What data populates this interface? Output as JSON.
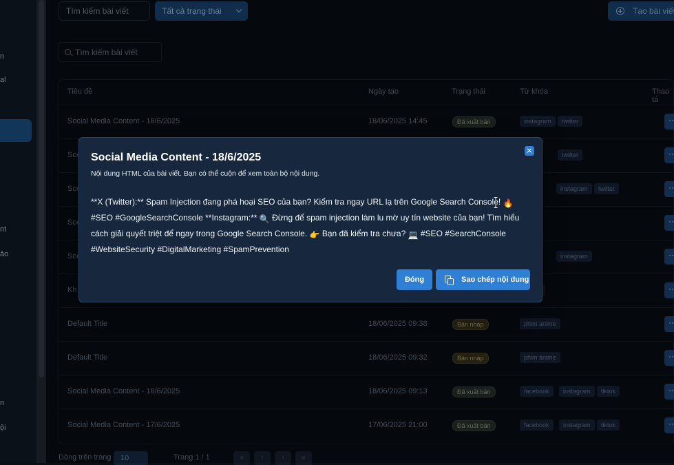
{
  "sidebar": {
    "fragments": [
      "n",
      "al",
      "nt",
      "ảo",
      "n",
      "ội"
    ]
  },
  "filters": {
    "search_placeholder": "Tìm kiếm bài viết",
    "status_label": "Tất cả trạng thái",
    "create_label": "Tạo bài viết"
  },
  "table_search": {
    "placeholder": "Tìm kiếm bài viết"
  },
  "table": {
    "headers": [
      "Tiêu đề",
      "Ngày tạo",
      "Trạng thái",
      "Từ khóa",
      "Thao tá"
    ],
    "rows": [
      {
        "title": "Social Media Content - 18/6/2025",
        "date": "18/06/2025 14:45",
        "status": "Đã xuất bản",
        "keywords": [
          "instagram",
          "twitter"
        ]
      },
      {
        "title": "Soc",
        "date": "",
        "status": "",
        "keywords": [
          "gram",
          "twitter"
        ]
      },
      {
        "title": "Soc",
        "date": "",
        "status": "",
        "keywords": [
          "tok",
          "instagram",
          "twitter"
        ]
      },
      {
        "title": "Soc",
        "date": "",
        "status": "",
        "keywords": [
          "tok"
        ]
      },
      {
        "title": "Soc",
        "date": "",
        "status": "",
        "keywords": [
          "tok",
          "instagram"
        ]
      },
      {
        "title": "Kh",
        "date": "",
        "status": "",
        "keywords": [
          "anime"
        ]
      },
      {
        "title": "Default Title",
        "date": "18/06/2025 09:38",
        "status": "Bản nháp",
        "keywords": [
          "phim anime"
        ]
      },
      {
        "title": "Default Title",
        "date": "18/06/2025 09:32",
        "status": "Bản nháp",
        "keywords": [
          "phim anime"
        ]
      },
      {
        "title": "Social Media Content - 18/6/2025",
        "date": "18/06/2025 09:13",
        "status": "Đã xuất bản",
        "keywords": [
          "facebook",
          "instagram",
          "tiktok"
        ]
      },
      {
        "title": "Social Media Content - 17/6/2025",
        "date": "17/06/2025 21:00",
        "status": "Đã xuất bản",
        "keywords": [
          "facebook",
          "instagram",
          "tiktok"
        ]
      }
    ],
    "action_label": "···"
  },
  "pagination": {
    "rows_label": "Dòng trên trang",
    "rows_value": "10",
    "page_info": "Trang 1 / 1",
    "buttons": [
      "«",
      "‹",
      "›",
      "»"
    ]
  },
  "modal": {
    "title": "Social Media Content - 18/6/2025",
    "subtitle": "Nội dung HTML của bài viết. Bạn có thể cuộn để xem toàn bộ nội dung.",
    "body_part1": "**X (Twitter):** Spam Injection đang phá hoại SEO của bạn? Kiểm tra ngay URL lạ trên Google Search Console! ",
    "emoji1": "🔥",
    "body_part2": " #SEO #GoogleSearchConsole **Instagram:** ",
    "emoji2": "🔍",
    "body_part3": " Đừng để spam injection làm lu mờ uy tín website của bạn! Tìm hiểu cách giải quyết triệt để ngay trong Google Search Console. ",
    "emoji3": "👉",
    "body_part4": " Bạn đã kiểm tra chưa? ",
    "emoji4": "💻",
    "body_part5": " #SEO #SearchConsole #WebsiteSecurity #DigitalMarketing #SpamPrevention",
    "close_label": "Đóng",
    "copy_label": "Sao chép nội dung"
  },
  "colors": {
    "accent": "#2f7fd4",
    "modal_bg": "#17273d",
    "page_bg": "#070b11"
  }
}
